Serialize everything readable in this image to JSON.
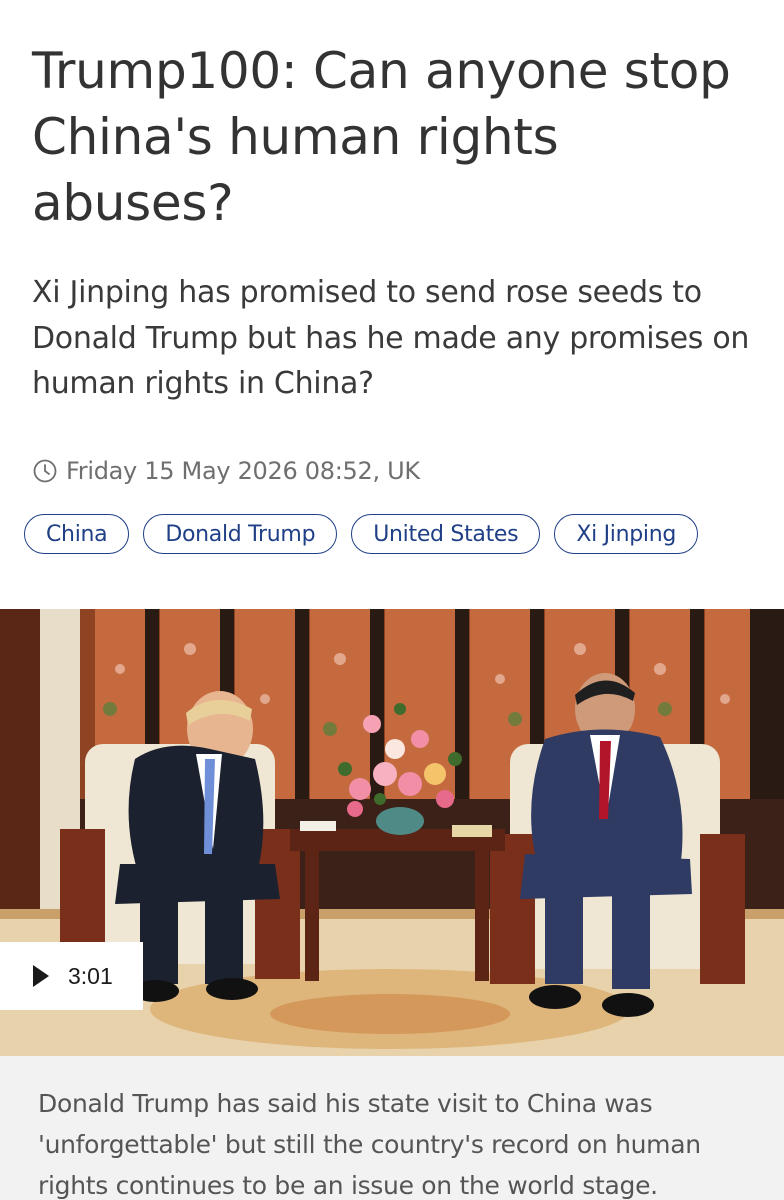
{
  "article": {
    "headline": "Trump100: Can anyone stop China's human rights abuses?",
    "standfirst": "Xi Jinping has promised to send rose seeds to Donald Trump but has he made any promises on human rights in China?",
    "dateline": "Friday 15 May 2026 08:52, UK",
    "tags": [
      "China",
      "Donald Trump",
      "United States",
      "Xi Jinping"
    ]
  },
  "video": {
    "duration": "3:01"
  },
  "caption": "Donald Trump has said his state visit to China was 'unforgettable' but still the country's record on human rights continues to be an issue on the world stage.",
  "icons": {
    "clock": "clock-icon",
    "play": "play-icon"
  },
  "colors": {
    "tag_accent": "#1f3f86",
    "headline_text": "#333333",
    "meta_text": "#6f6f6f",
    "caption_background": "#f2f2f2"
  }
}
